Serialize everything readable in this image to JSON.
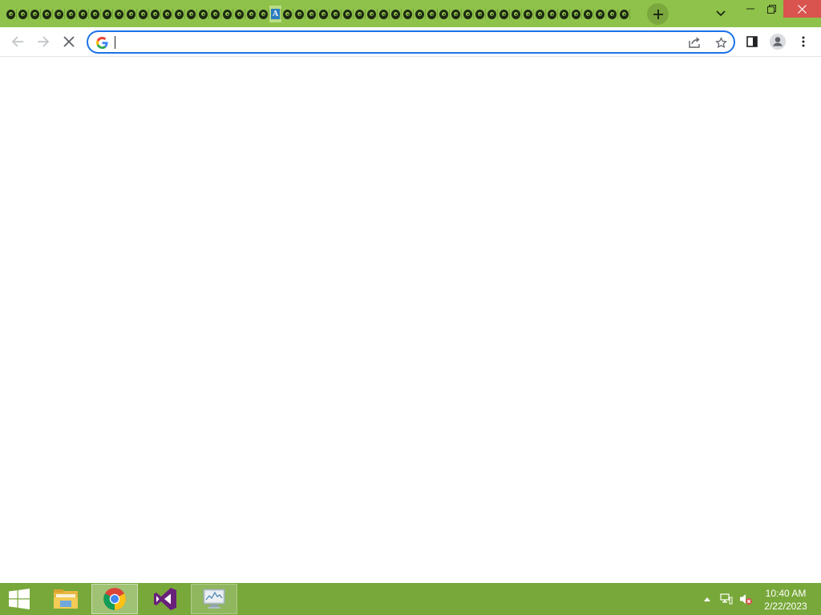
{
  "browser": {
    "tabs": {
      "count": 52,
      "active_index": 22,
      "favicon_active": "A"
    },
    "window_controls": {
      "new_tab": "new-tab-plus-icon",
      "tab_search": "chevron-down-icon",
      "minimize": "minimize-icon",
      "restore": "restore-icon",
      "close": "close-icon"
    },
    "toolbar": {
      "back": "back-arrow-icon",
      "forward": "forward-arrow-icon",
      "stop": "stop-x-icon",
      "sidebar": "side-panel-icon",
      "profile": "profile-icon",
      "menu": "kebab-menu-icon"
    },
    "omnibox": {
      "value": "",
      "placeholder": "",
      "share_icon": "share-icon",
      "bookmark_icon": "star-icon"
    }
  },
  "taskbar": {
    "apps": [
      {
        "name": "Start",
        "icon": "windows-logo-icon",
        "state": "none"
      },
      {
        "name": "File Explorer",
        "icon": "folder-icon",
        "state": "none"
      },
      {
        "name": "Google Chrome",
        "icon": "chrome-icon",
        "state": "active"
      },
      {
        "name": "Visual Studio",
        "icon": "visual-studio-icon",
        "state": "none"
      },
      {
        "name": "Performance Monitor",
        "icon": "monitor-icon",
        "state": "open"
      }
    ],
    "tray": {
      "overflow": "up-caret-icon",
      "network": "network-icon",
      "volume": "volume-muted-icon"
    },
    "clock": {
      "time": "10:40 AM",
      "date": "2/22/2023"
    }
  },
  "colors": {
    "accent": "#8fc24a",
    "taskbar": "#78a83a",
    "omnibox_border": "#1a73e8",
    "close_button": "#d9534f"
  }
}
